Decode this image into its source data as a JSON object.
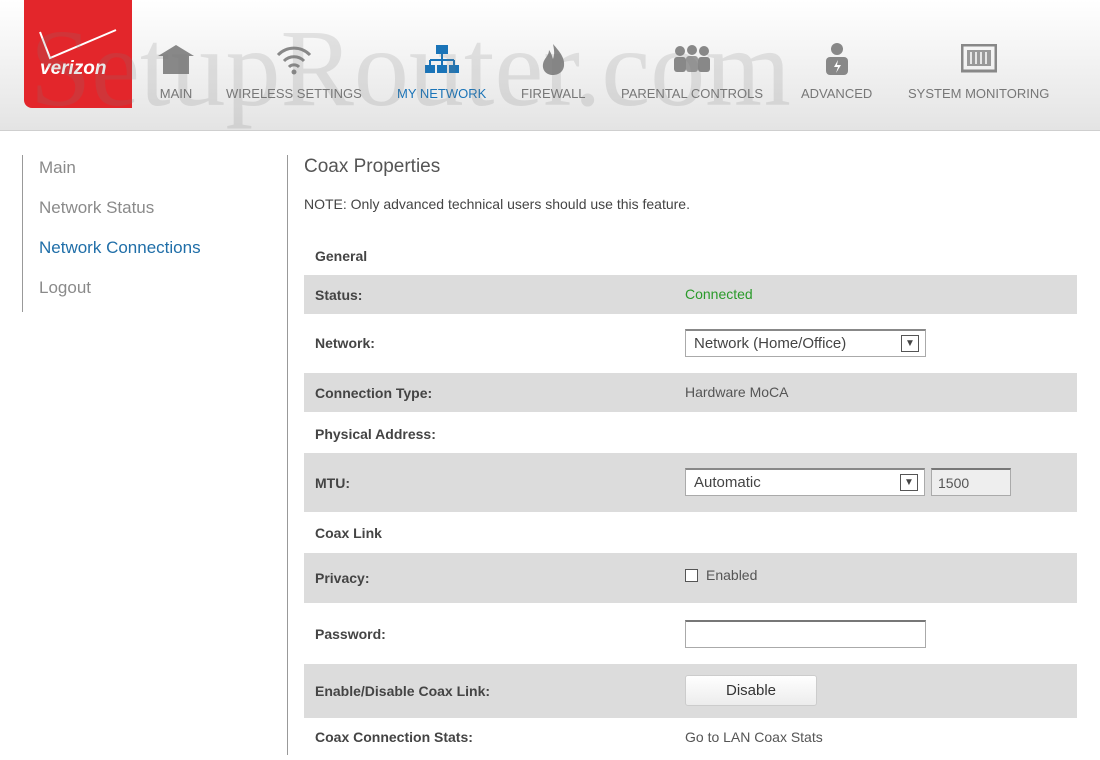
{
  "brand": {
    "logo_text": "verizon",
    "watermark": "SetupRouter.com"
  },
  "nav": [
    {
      "label": "MAIN",
      "icon": "house-icon"
    },
    {
      "label": "WIRELESS SETTINGS",
      "icon": "wifi-icon"
    },
    {
      "label": "MY NETWORK",
      "icon": "network-icon",
      "active": true
    },
    {
      "label": "FIREWALL",
      "icon": "flame-icon"
    },
    {
      "label": "PARENTAL CONTROLS",
      "icon": "family-icon"
    },
    {
      "label": "ADVANCED",
      "icon": "user-gear-icon"
    },
    {
      "label": "SYSTEM MONITORING",
      "icon": "monitor-icon"
    }
  ],
  "accent": "#1a74b8",
  "sidebar": {
    "items": [
      {
        "label": "Main"
      },
      {
        "label": "Network Status"
      },
      {
        "label": "Network Connections",
        "active": true
      },
      {
        "label": "Logout"
      }
    ]
  },
  "main": {
    "title": "Coax Properties",
    "note": "NOTE: Only advanced technical users should use this feature.",
    "general": "General",
    "status_label": "Status:",
    "status_value": "Connected",
    "status_color": "#2a9a2a",
    "network_label": "Network:",
    "network_value": "Network (Home/Office)",
    "conn_type_label": "Connection Type:",
    "conn_type_value": "Hardware MoCA",
    "phys_label": "Physical Address:",
    "mtu_label": "MTU:",
    "mtu_mode": "Automatic",
    "mtu_value": "1500",
    "coax_link": "Coax Link",
    "privacy_label": "Privacy:",
    "privacy_option": "Enabled",
    "privacy_checked": false,
    "password_label": "Password:",
    "password_value": "",
    "enable_label": "Enable/Disable Coax Link:",
    "disable_button": "Disable",
    "stats_label": "Coax Connection Stats:",
    "stats_link": "Go to LAN Coax Stats"
  }
}
